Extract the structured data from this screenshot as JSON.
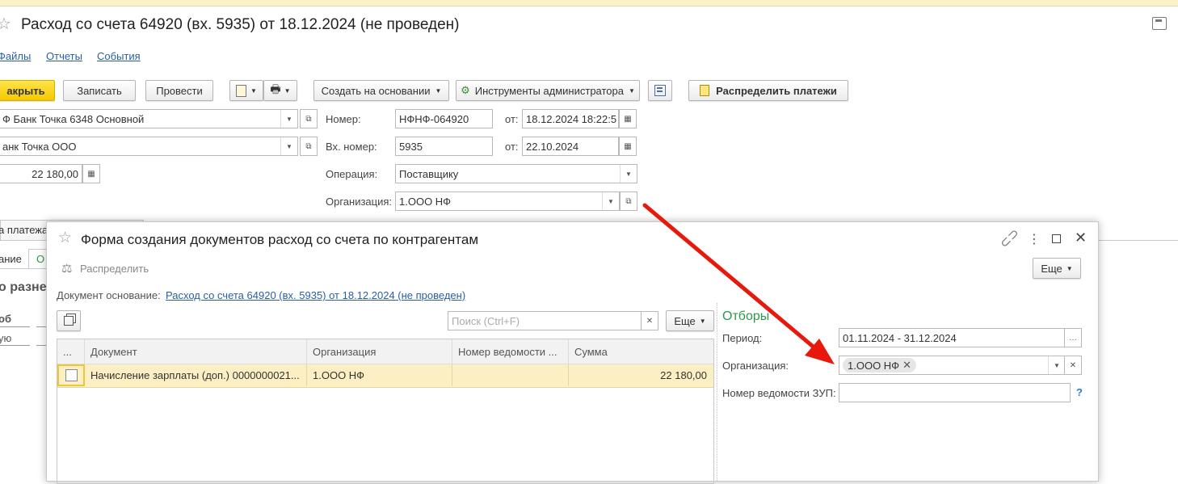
{
  "document": {
    "title": "Расход со счета 64920 (вх. 5935) от 18.12.2024 (не проведен)",
    "nav": [
      "Файлы",
      "Отчеты",
      "События"
    ]
  },
  "toolbar": {
    "close": "акрыть",
    "write": "Записать",
    "post": "Провести",
    "create_based": "Создать на основании",
    "admin_tools": "Инструменты администратора",
    "distribute_payments": "Распределить платежи"
  },
  "form": {
    "account": "Ф Банк Точка 6348 Основной",
    "bank": "анк Точка ООО",
    "amount": "22 180,00",
    "number_label": "Номер:",
    "number": "НФНФ-064920",
    "from_label": "от:",
    "date": "18.12.2024 18:22:5",
    "in_number_label": "Вх. номер:",
    "in_number": "5935",
    "in_date": "22.10.2024",
    "operation_label": "Операция:",
    "operation": "Поставщику",
    "org_label": "Организация:",
    "org": "1.ООО НФ",
    "bg_tab1": "а платежа",
    "bg_tab2": "ание",
    "bg_tab3": "О",
    "bg_section": "о разне",
    "bg_col": "об",
    "bg_val": "ую"
  },
  "dialog": {
    "title": "Форма создания документов расход со счета по контрагентам",
    "distribute": "Распределить",
    "more": "Еще",
    "base_doc_label": "Документ основание:",
    "base_doc": "Расход со счета 64920 (вх. 5935) от 18.12.2024 (не проведен)",
    "search_placeholder": "Поиск (Ctrl+F)",
    "table": {
      "columns": [
        "...",
        "Документ",
        "Организация",
        "Номер ведомости ...",
        "Сумма"
      ],
      "rows": [
        {
          "document": "Начисление зарплаты (доп.) 0000000021...",
          "org": "1.ООО НФ",
          "sheet": "",
          "sum": "22 180,00"
        }
      ]
    },
    "filters": {
      "title": "Отборы",
      "period_label": "Период:",
      "period": "01.11.2024 - 31.12.2024",
      "org_label": "Организация:",
      "org_tag": "1.ООО НФ",
      "sheet_label": "Номер ведомости ЗУП:",
      "help": "?"
    }
  },
  "colors": {
    "accent_yellow": "#f5c900",
    "link": "#2a5ea8",
    "filters_title": "#2a9a4a",
    "arrow": "#e8190c",
    "row_highlight": "#fcefc4"
  }
}
